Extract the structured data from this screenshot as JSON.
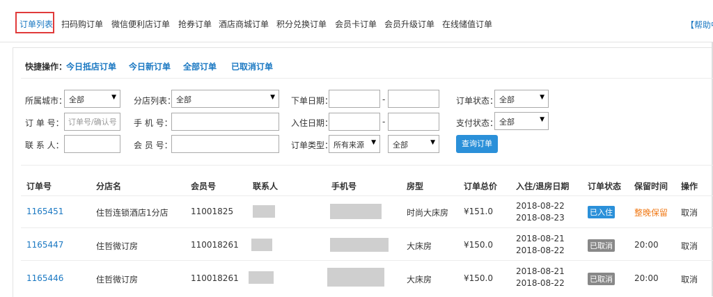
{
  "nav": {
    "tabs": [
      "订单列表",
      "扫码购订单",
      "微信便利店订单",
      "抢券订单",
      "酒店商城订单",
      "积分兑换订单",
      "会员卡订单",
      "会员升级订单",
      "在线储值订单"
    ],
    "help": "【帮助中"
  },
  "quick": {
    "label": "快捷操作：",
    "links": [
      "今日抵店订单",
      "今日新订单",
      "全部订单",
      "已取消订单"
    ]
  },
  "filters": {
    "city_label": "所属城市：",
    "city_value": "全部",
    "branch_label": "分店列表：",
    "branch_value": "全部",
    "order_date_label": "下单日期：",
    "order_status_label": "订单状态：",
    "order_status_value": "全部",
    "order_no_label": "订 单 号：",
    "order_no_placeholder": "订单号/确认号",
    "phone_label": "手 机 号：",
    "checkin_date_label": "入住日期：",
    "pay_status_label": "支付状态：",
    "pay_status_value": "全部",
    "contact_label": "联 系 人：",
    "member_label": "会 员 号：",
    "order_type_label": "订单类型：",
    "order_type_value": "所有来源",
    "order_type_value2": "全部",
    "dash": "-",
    "query_button": "查询订单"
  },
  "table": {
    "headers": [
      "订单号",
      "分店名",
      "会员号",
      "联系人",
      "手机号",
      "房型",
      "订单总价",
      "入住/退房日期",
      "订单状态",
      "保留时间",
      "操作"
    ],
    "rows": [
      {
        "order_no": "1165451",
        "branch": "住哲连锁酒店1分店",
        "member": "11001825",
        "room": "时尚大床房",
        "price": "¥151.0",
        "checkin": "2018-08-22",
        "checkout": "2018-08-23",
        "status": "已入住",
        "retain": "整晚保留",
        "action": "取消"
      },
      {
        "order_no": "1165447",
        "branch": "住哲微订房",
        "member": "110018261",
        "room": "大床房",
        "price": "¥150.0",
        "checkin": "2018-08-21",
        "checkout": "2018-08-22",
        "status": "已取消",
        "retain": "20:00",
        "action": "取消"
      },
      {
        "order_no": "1165446",
        "branch": "住哲微订房",
        "member": "110018261",
        "room": "大床房",
        "price": "¥150.0",
        "checkin": "2018-08-21",
        "checkout": "2018-08-22",
        "status": "已取消",
        "retain": "20:00",
        "action": "取消"
      }
    ]
  }
}
